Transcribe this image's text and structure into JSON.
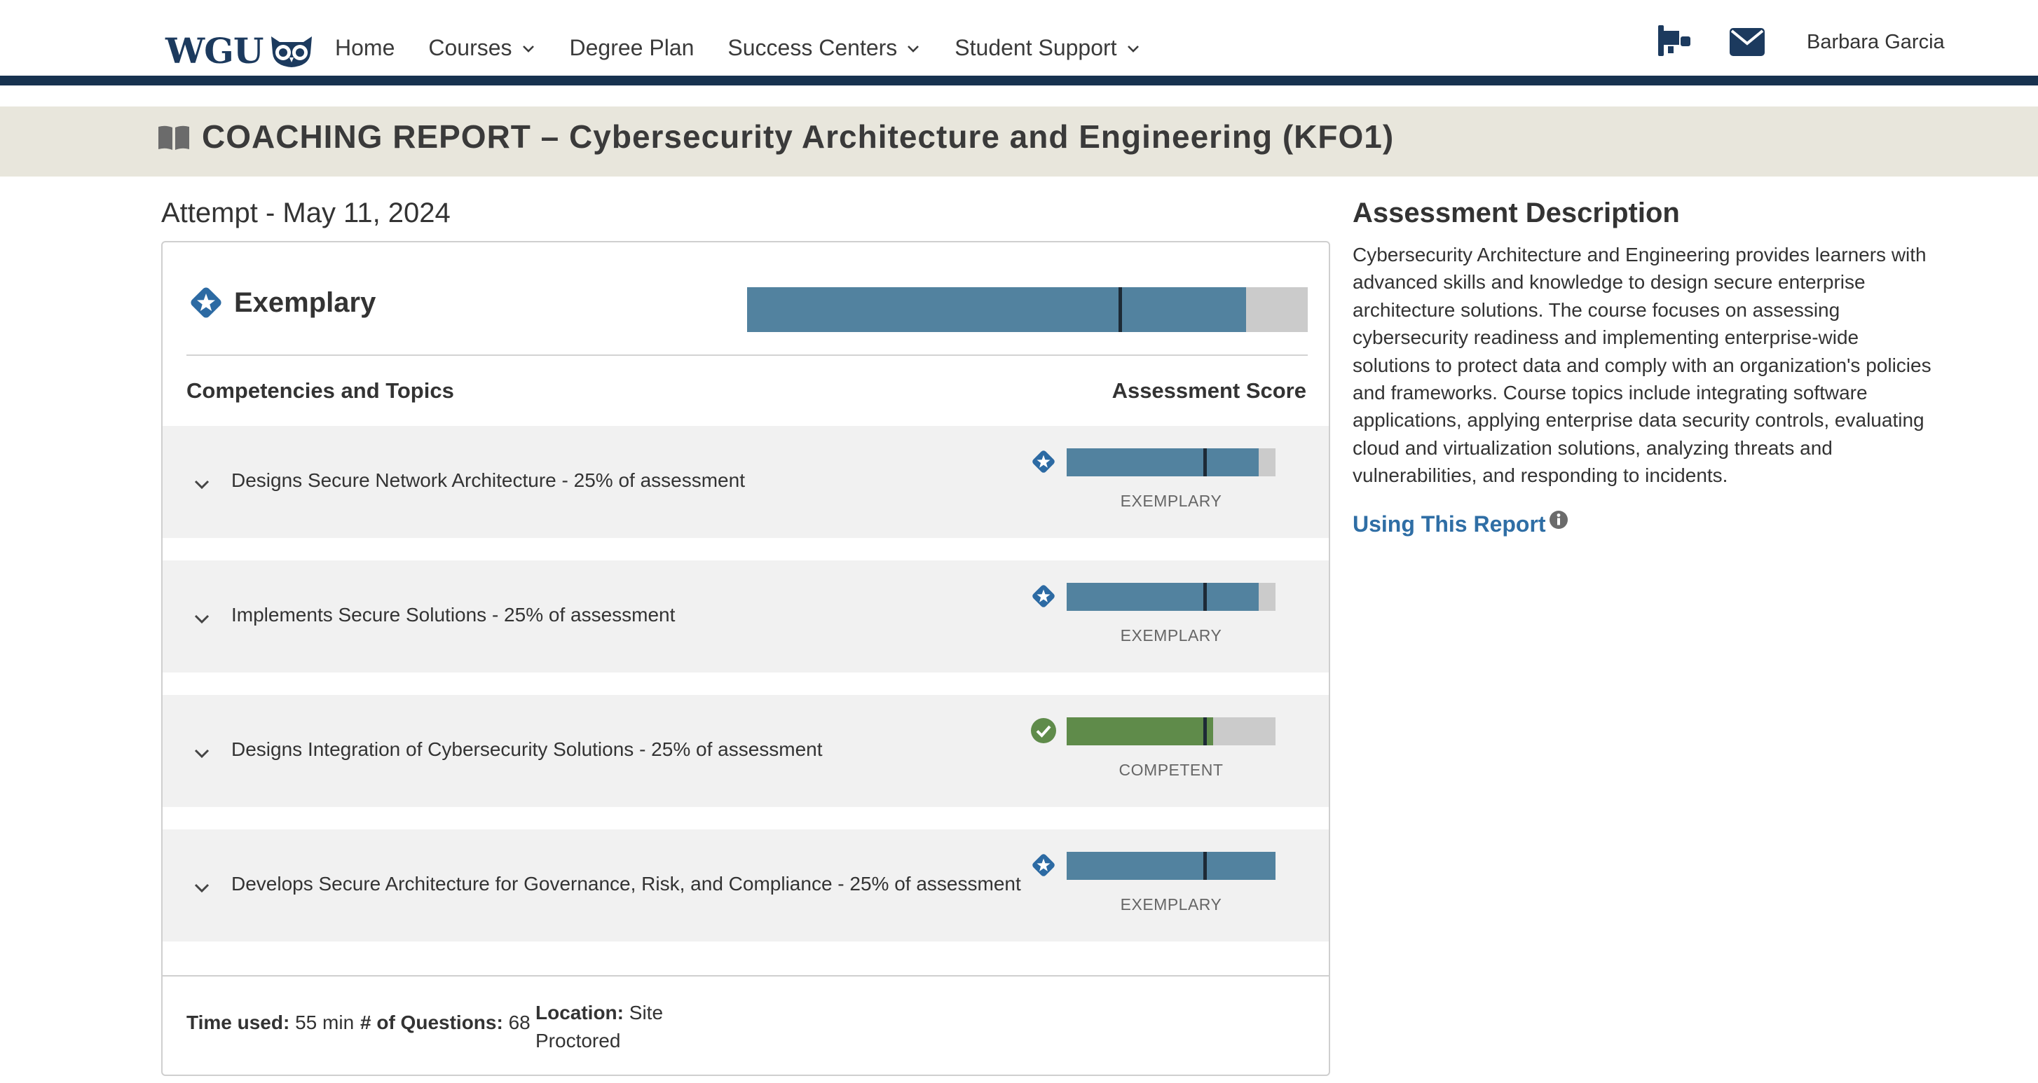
{
  "nav": {
    "logo_text": "WGU",
    "items": [
      {
        "label": "Home",
        "dropdown": false
      },
      {
        "label": "Courses",
        "dropdown": true
      },
      {
        "label": "Degree Plan",
        "dropdown": false
      },
      {
        "label": "Success Centers",
        "dropdown": true
      },
      {
        "label": "Student Support",
        "dropdown": true
      }
    ],
    "icons": [
      "megaphone-icon",
      "mail-icon"
    ],
    "user_name": "Barbara Garcia"
  },
  "page": {
    "title": "COACHING REPORT – Cybersecurity Architecture and Engineering (KFO1)",
    "attempt": "Attempt - May 11, 2024"
  },
  "report": {
    "overall": {
      "label": "Exemplary",
      "score_fraction": 0.89,
      "threshold_fraction": 0.665,
      "icon": "star-badge-icon"
    },
    "columns": {
      "left": "Competencies and Topics",
      "right": "Assessment Score"
    },
    "competencies": [
      {
        "label": "Designs Secure Network Architecture - 25% of assessment",
        "level": "EXEMPLARY",
        "score_fraction": 0.92,
        "threshold_fraction": 0.66,
        "icon": "star-badge-icon"
      },
      {
        "label": "Implements Secure Solutions - 25% of assessment",
        "level": "EXEMPLARY",
        "score_fraction": 0.92,
        "threshold_fraction": 0.66,
        "icon": "star-badge-icon"
      },
      {
        "label": "Designs Integration of Cybersecurity Solutions - 25% of assessment",
        "level": "COMPETENT",
        "score_fraction": 0.7,
        "threshold_fraction": 0.66,
        "icon": "check-circle-icon"
      },
      {
        "label": "Develops Secure Architecture for Governance, Risk, and Compliance - 25% of assessment",
        "level": "EXEMPLARY",
        "score_fraction": 1.0,
        "threshold_fraction": 0.66,
        "icon": "star-badge-icon"
      }
    ],
    "footer": {
      "time_label": "Time used:",
      "time_value": "55 min",
      "questions_label": "# of Questions:",
      "questions_value": "68",
      "location_label": "Location:",
      "location_value": "Site Proctored"
    }
  },
  "description": {
    "title": "Assessment Description",
    "body": "Cybersecurity Architecture and Engineering provides learners with advanced skills and knowledge to design secure enterprise architecture solutions. The course focuses on assessing cybersecurity readiness and implementing enterprise-wide solutions to protect data and comply with an organization's policies and frameworks. Course topics include integrating software applications, applying enterprise data security controls, evaluating cloud and virtualization solutions, analyzing threats and vulnerabilities, and responding to incidents.",
    "link_label": "Using This Report"
  },
  "colors": {
    "exemplary": "#52829f",
    "competent": "#5f8b4a",
    "badge_blue": "#2c6aa3",
    "badge_green": "#5f8b4a",
    "navy": "#17324f",
    "marker": "#1d2a36",
    "track": "#cbcbcb"
  }
}
